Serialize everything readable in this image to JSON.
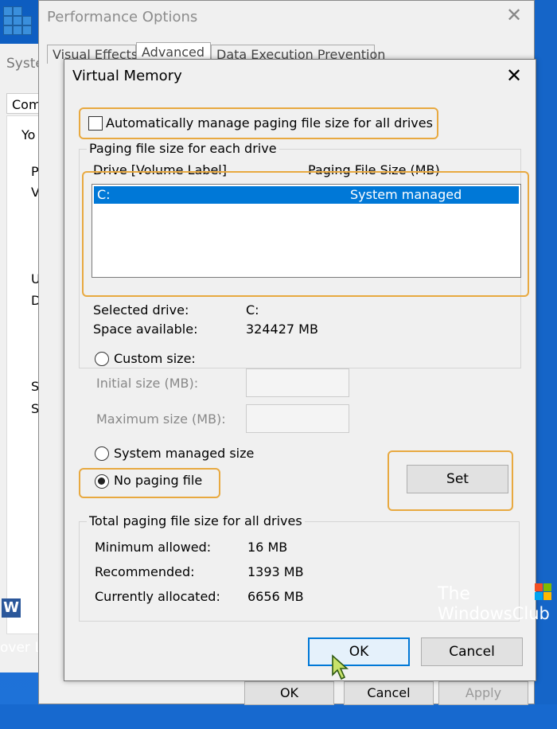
{
  "background": {
    "system_window_title": "Syste",
    "system_tab": "Com",
    "clipped_texts": [
      "Yo",
      "P",
      "V",
      "U",
      "D",
      "S",
      "S"
    ],
    "taskbar_text": "over Le"
  },
  "performance_options": {
    "title": "Performance Options",
    "tabs": [
      "Visual Effects",
      "Advanced",
      "Data Execution Prevention"
    ],
    "ok_label": "OK",
    "cancel_label": "Cancel",
    "apply_label": "Apply"
  },
  "virtual_memory": {
    "title": "Virtual Memory",
    "auto_manage_label": "Automatically manage paging file size for all drives",
    "auto_manage_checked": false,
    "paging_group_title": "Paging file size for each drive",
    "col_drive": "Drive  [Volume Label]",
    "col_size": "Paging File Size (MB)",
    "drives": [
      {
        "drive": "C:",
        "size": "System managed",
        "selected": true
      }
    ],
    "selected_drive_label": "Selected drive:",
    "selected_drive_value": "C:",
    "space_available_label": "Space available:",
    "space_available_value": "324427 MB",
    "custom_size_label": "Custom size:",
    "initial_size_label": "Initial size (MB):",
    "initial_size_value": "",
    "maximum_size_label": "Maximum size (MB):",
    "maximum_size_value": "",
    "system_managed_label": "System managed size",
    "no_paging_label": "No paging file",
    "selected_option": "no-paging-file",
    "set_label": "Set",
    "total_group_title": "Total paging file size for all drives",
    "minimum_allowed_label": "Minimum allowed:",
    "minimum_allowed_value": "16 MB",
    "recommended_label": "Recommended:",
    "recommended_value": "1393 MB",
    "currently_allocated_label": "Currently allocated:",
    "currently_allocated_value": "6656 MB",
    "ok_label": "OK",
    "cancel_label": "Cancel"
  },
  "watermark": {
    "line1": "The",
    "line2": "WindowsClub"
  },
  "colors": {
    "highlight": "#e8a940",
    "selection": "#0078d7",
    "desktop": "#1565c8"
  }
}
